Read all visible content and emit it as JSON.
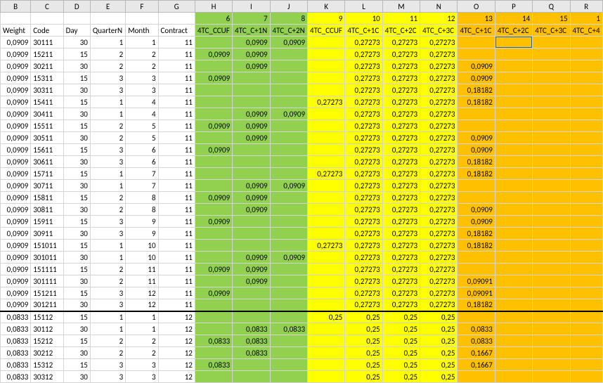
{
  "cols": [
    "B",
    "C",
    "D",
    "E",
    "F",
    "G",
    "H",
    "I",
    "J",
    "K",
    "L",
    "M",
    "N",
    "O",
    "P",
    "Q",
    "R"
  ],
  "numrow": [
    "",
    "",
    "",
    "",
    "",
    "",
    "6",
    "7",
    "8",
    "9",
    "10",
    "11",
    "12",
    "13",
    "14",
    "15",
    "1"
  ],
  "headers": [
    "Weight",
    "Code",
    "Day",
    "QuarterN",
    "Month",
    "Contract",
    "4TC_CCUF",
    "4TC_C+1N",
    "4TC_C+2N",
    "4TC_CCUF",
    "4TC_C+1C",
    "4TC_C+2C",
    "4TC_C+3C",
    "4TC_C+1C",
    "4TC_C+2C",
    "4TC_C+3C",
    "4TC_C+4"
  ],
  "rows": [
    [
      "0,0909",
      "30111",
      "30",
      "1",
      "1",
      "11",
      "",
      "0,0909",
      "0,0909",
      "",
      "0,27273",
      "0,27273",
      "0,27273",
      "",
      "",
      "",
      ""
    ],
    [
      "0,0909",
      "15211",
      "15",
      "2",
      "2",
      "11",
      "0,0909",
      "0,0909",
      "",
      "",
      "0,27273",
      "0,27273",
      "0,27273",
      "",
      "",
      "",
      ""
    ],
    [
      "0,0909",
      "30211",
      "30",
      "2",
      "2",
      "11",
      "",
      "0,0909",
      "",
      "",
      "0,27273",
      "0,27273",
      "0,27273",
      "0,0909",
      "",
      "",
      ""
    ],
    [
      "0,0909",
      "15311",
      "15",
      "3",
      "3",
      "11",
      "0,0909",
      "",
      "",
      "",
      "0,27273",
      "0,27273",
      "0,27273",
      "0,0909",
      "",
      "",
      ""
    ],
    [
      "0,0909",
      "30311",
      "30",
      "3",
      "3",
      "11",
      "",
      "",
      "",
      "",
      "0,27273",
      "0,27273",
      "0,27273",
      "0,18182",
      "",
      "",
      ""
    ],
    [
      "0,0909",
      "15411",
      "15",
      "1",
      "4",
      "11",
      "",
      "",
      "",
      "0,27273",
      "0,27273",
      "0,27273",
      "0,27273",
      "0,18182",
      "",
      "",
      ""
    ],
    [
      "0,0909",
      "30411",
      "30",
      "1",
      "4",
      "11",
      "",
      "0,0909",
      "0,0909",
      "",
      "0,27273",
      "0,27273",
      "0,27273",
      "",
      "",
      "",
      ""
    ],
    [
      "0,0909",
      "15511",
      "15",
      "2",
      "5",
      "11",
      "0,0909",
      "0,0909",
      "",
      "",
      "0,27273",
      "0,27273",
      "0,27273",
      "",
      "",
      "",
      ""
    ],
    [
      "0,0909",
      "30511",
      "30",
      "2",
      "5",
      "11",
      "",
      "0,0909",
      "",
      "",
      "0,27273",
      "0,27273",
      "0,27273",
      "0,0909",
      "",
      "",
      ""
    ],
    [
      "0,0909",
      "15611",
      "15",
      "3",
      "6",
      "11",
      "0,0909",
      "",
      "",
      "",
      "0,27273",
      "0,27273",
      "0,27273",
      "0,0909",
      "",
      "",
      ""
    ],
    [
      "0,0909",
      "30611",
      "30",
      "3",
      "6",
      "11",
      "",
      "",
      "",
      "",
      "0,27273",
      "0,27273",
      "0,27273",
      "0,18182",
      "",
      "",
      ""
    ],
    [
      "0,0909",
      "15711",
      "15",
      "1",
      "7",
      "11",
      "",
      "",
      "",
      "0,27273",
      "0,27273",
      "0,27273",
      "0,27273",
      "0,18182",
      "",
      "",
      ""
    ],
    [
      "0,0909",
      "30711",
      "30",
      "1",
      "7",
      "11",
      "",
      "0,0909",
      "0,0909",
      "",
      "0,27273",
      "0,27273",
      "0,27273",
      "",
      "",
      "",
      ""
    ],
    [
      "0,0909",
      "15811",
      "15",
      "2",
      "8",
      "11",
      "0,0909",
      "0,0909",
      "",
      "",
      "0,27273",
      "0,27273",
      "0,27273",
      "",
      "",
      "",
      ""
    ],
    [
      "0,0909",
      "30811",
      "30",
      "2",
      "8",
      "11",
      "",
      "0,0909",
      "",
      "",
      "0,27273",
      "0,27273",
      "0,27273",
      "0,0909",
      "",
      "",
      ""
    ],
    [
      "0,0909",
      "15911",
      "15",
      "3",
      "9",
      "11",
      "0,0909",
      "",
      "",
      "",
      "0,27273",
      "0,27273",
      "0,27273",
      "0,0909",
      "",
      "",
      ""
    ],
    [
      "0,0909",
      "30911",
      "30",
      "3",
      "9",
      "11",
      "",
      "",
      "",
      "",
      "0,27273",
      "0,27273",
      "0,27273",
      "0,18182",
      "",
      "",
      ""
    ],
    [
      "0,0909",
      "151011",
      "15",
      "1",
      "10",
      "11",
      "",
      "",
      "",
      "0,27273",
      "0,27273",
      "0,27273",
      "0,27273",
      "0,18182",
      "",
      "",
      ""
    ],
    [
      "0,0909",
      "301011",
      "30",
      "1",
      "10",
      "11",
      "",
      "0,0909",
      "0,0909",
      "",
      "0,27273",
      "0,27273",
      "0,27273",
      "",
      "",
      "",
      ""
    ],
    [
      "0,0909",
      "151111",
      "15",
      "2",
      "11",
      "11",
      "0,0909",
      "0,0909",
      "",
      "",
      "0,27273",
      "0,27273",
      "0,27273",
      "",
      "",
      "",
      ""
    ],
    [
      "0,0909",
      "301111",
      "30",
      "2",
      "11",
      "11",
      "",
      "0,0909",
      "",
      "",
      "0,27273",
      "0,27273",
      "0,27273",
      "0,09091",
      "",
      "",
      ""
    ],
    [
      "0,0909",
      "151211",
      "15",
      "3",
      "12",
      "11",
      "0,0909",
      "",
      "",
      "",
      "0,27273",
      "0,27273",
      "0,27273",
      "0,09091",
      "",
      "",
      ""
    ],
    [
      "0,0909",
      "301211",
      "30",
      "3",
      "12",
      "11",
      "",
      "",
      "",
      "",
      "0,27273",
      "0,27273",
      "0,27273",
      "0,18182",
      "",
      "",
      ""
    ],
    [
      "0,0833",
      "15112",
      "15",
      "1",
      "1",
      "12",
      "",
      "",
      "",
      "0,25",
      "0,25",
      "0,25",
      "0,25",
      "",
      "",
      "",
      ""
    ],
    [
      "0,0833",
      "30112",
      "30",
      "1",
      "1",
      "12",
      "",
      "0,0833",
      "0,0833",
      "",
      "0,25",
      "0,25",
      "0,25",
      "0,0833",
      "",
      "",
      ""
    ],
    [
      "0,0833",
      "15212",
      "15",
      "2",
      "2",
      "12",
      "0,0833",
      "0,0833",
      "",
      "",
      "0,25",
      "0,25",
      "0,25",
      "0,0833",
      "",
      "",
      ""
    ],
    [
      "0,0833",
      "30212",
      "30",
      "2",
      "2",
      "12",
      "",
      "0,0833",
      "",
      "",
      "0,25",
      "0,25",
      "0,25",
      "0,1667",
      "",
      "",
      ""
    ],
    [
      "0,0833",
      "15312",
      "15",
      "3",
      "3",
      "12",
      "0,0833",
      "",
      "",
      "",
      "0,25",
      "0,25",
      "0,25",
      "0,1667",
      "",
      "",
      ""
    ],
    [
      "0,0833",
      "30312",
      "30",
      "3",
      "3",
      "12",
      "",
      "",
      "",
      "",
      "0,25",
      "0,25",
      "0,25",
      "",
      "",
      "",
      ""
    ]
  ],
  "zones": {
    "greenStart": 6,
    "greenEnd": 8,
    "yellowStart": 9,
    "yellowEnd": 12,
    "orangeStart": 13,
    "orangeEnd": 16
  },
  "selectedRow": 0,
  "selectedCol": 14,
  "thickRow": 22
}
